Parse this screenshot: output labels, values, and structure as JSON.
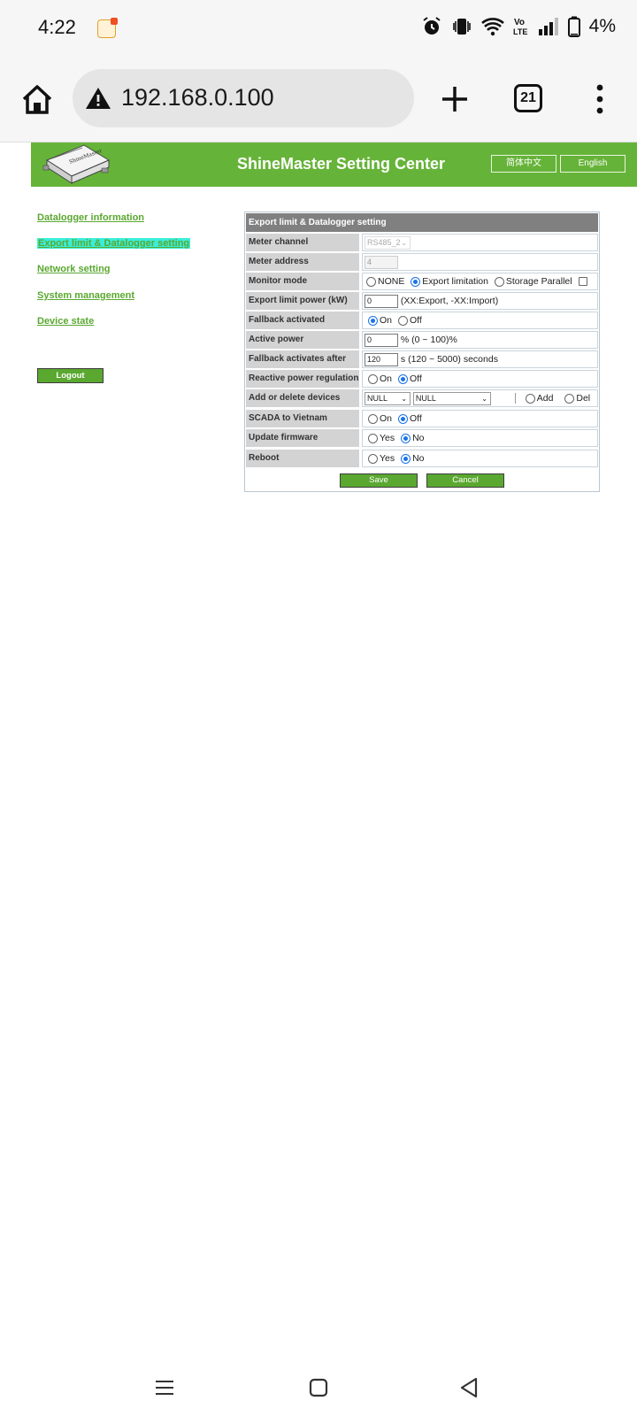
{
  "status_bar": {
    "time": "4:22",
    "battery": "4%",
    "icons": [
      "app-notification-icon",
      "alarm-icon",
      "vibrate-icon",
      "wifi-icon",
      "volte-icon",
      "signal-icon",
      "battery-icon"
    ]
  },
  "browser": {
    "url": "192.168.0.100",
    "tab_count": "21"
  },
  "header": {
    "title": "ShineMaster Setting Center",
    "lang_zh": "简体中文",
    "lang_en": "English"
  },
  "sidebar": {
    "items": [
      {
        "label": "Datalogger information"
      },
      {
        "label": "Export limit & Datalogger setting"
      },
      {
        "label": "Network setting"
      },
      {
        "label": "System management"
      },
      {
        "label": "Device state"
      }
    ],
    "active_index": 1,
    "logout": "Logout"
  },
  "form": {
    "title": "Export limit & Datalogger setting",
    "meter_channel": {
      "label": "Meter channel",
      "value": "RS485_2"
    },
    "meter_address": {
      "label": "Meter address",
      "value": "4"
    },
    "monitor_mode": {
      "label": "Monitor mode",
      "options": [
        "NONE",
        "Export limitation",
        "Storage Parallel"
      ],
      "selected": "Export limitation",
      "storage_checked": false
    },
    "export_limit_power": {
      "label": "Export limit power (kW)",
      "value": "0",
      "hint": "(XX:Export, -XX:Import)"
    },
    "fallback_activated": {
      "label": "Fallback activated",
      "options": [
        "On",
        "Off"
      ],
      "selected": "On"
    },
    "active_power": {
      "label": "Active power",
      "value": "0",
      "hint": "% (0 ~ 100)%"
    },
    "fallback_after": {
      "label": "Fallback activates after",
      "value": "120",
      "hint": "s (120 ~ 5000) seconds"
    },
    "reactive_power": {
      "label": "Reactive power regulation",
      "options": [
        "On",
        "Off"
      ],
      "selected": "Off"
    },
    "add_delete": {
      "label": "Add or delete devices",
      "select1": "NULL",
      "select2": "NULL",
      "options": [
        "Add",
        "Del"
      ]
    },
    "scada": {
      "label": "SCADA to Vietnam",
      "options": [
        "On",
        "Off"
      ],
      "selected": "Off"
    },
    "update_firmware": {
      "label": "Update firmware",
      "options": [
        "Yes",
        "No"
      ],
      "selected": "No"
    },
    "reboot": {
      "label": "Reboot",
      "options": [
        "Yes",
        "No"
      ],
      "selected": "No"
    },
    "save": "Save",
    "cancel": "Cancel"
  }
}
